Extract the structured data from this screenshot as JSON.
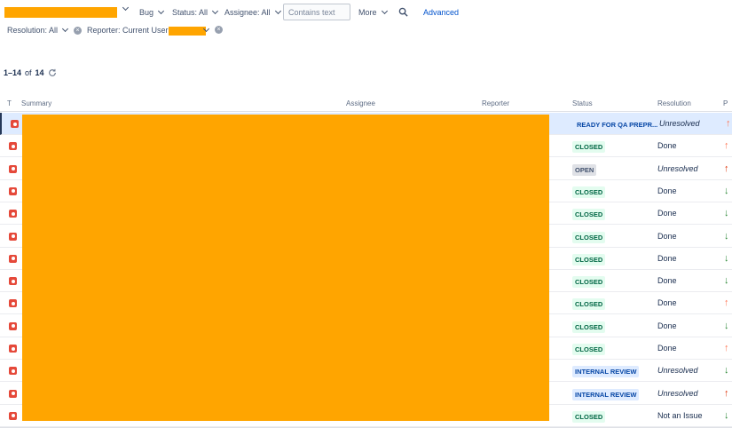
{
  "filters": {
    "type_label": "Bug",
    "status_label": "Status: All",
    "assignee_label": "Assignee: All",
    "search_placeholder": "Contains text",
    "more_label": "More",
    "advanced_label": "Advanced",
    "resolution_label": "Resolution: All",
    "reporter_label": "Reporter: Current User:"
  },
  "results": {
    "range": "1–14",
    "of": "of",
    "total": "14"
  },
  "columns": {
    "type": "T",
    "summary": "Summary",
    "assignee": "Assignee",
    "reporter": "Reporter",
    "status": "Status",
    "resolution": "Resolution",
    "priority": "P"
  },
  "rows": [
    {
      "status": "READY FOR QA PREPR...",
      "status_style": "blue",
      "resolution": "Unresolved",
      "priority": "up-orange"
    },
    {
      "status": "CLOSED",
      "status_style": "closed",
      "resolution": "Done",
      "priority": "up-orange"
    },
    {
      "status": "OPEN",
      "status_style": "open",
      "resolution": "Unresolved",
      "priority": "up-red"
    },
    {
      "status": "CLOSED",
      "status_style": "closed",
      "resolution": "Done",
      "priority": "down-green"
    },
    {
      "status": "CLOSED",
      "status_style": "closed",
      "resolution": "Done",
      "priority": "down-green"
    },
    {
      "status": "CLOSED",
      "status_style": "closed",
      "resolution": "Done",
      "priority": "down-green"
    },
    {
      "status": "CLOSED",
      "status_style": "closed",
      "resolution": "Done",
      "priority": "down-green"
    },
    {
      "status": "CLOSED",
      "status_style": "closed",
      "resolution": "Done",
      "priority": "down-green"
    },
    {
      "status": "CLOSED",
      "status_style": "closed",
      "resolution": "Done",
      "priority": "up-orange"
    },
    {
      "status": "CLOSED",
      "status_style": "closed",
      "resolution": "Done",
      "priority": "down-green"
    },
    {
      "status": "CLOSED",
      "status_style": "closed",
      "resolution": "Done",
      "priority": "up-orange"
    },
    {
      "status": "INTERNAL REVIEW",
      "status_style": "blue",
      "resolution": "Unresolved",
      "priority": "down-green"
    },
    {
      "status": "INTERNAL REVIEW",
      "status_style": "blue",
      "resolution": "Unresolved",
      "priority": "up-red"
    },
    {
      "status": "CLOSED",
      "status_style": "closed",
      "resolution": "Not an Issue",
      "priority": "down-green"
    }
  ],
  "colors": {
    "redaction": "#ffa500",
    "link": "#0052cc",
    "bug": "#e5493a"
  }
}
